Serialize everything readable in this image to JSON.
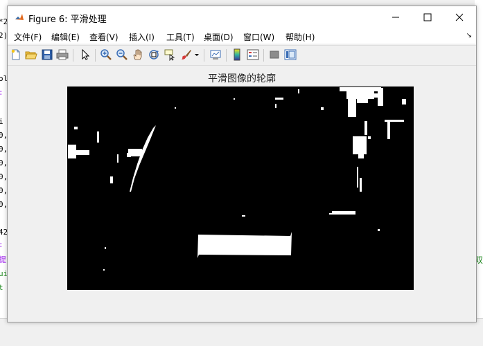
{
  "window": {
    "title": "Figure 6: 平滑处理",
    "controls": [
      "minimize",
      "maximize",
      "close"
    ]
  },
  "menu": {
    "items": [
      "文件(F)",
      "编辑(E)",
      "查看(V)",
      "插入(I)",
      "工具(T)",
      "桌面(D)",
      "窗口(W)",
      "帮助(H)"
    ]
  },
  "toolbar": {
    "buttons": [
      "new-figure-icon",
      "open-file-icon",
      "save-icon",
      "print-icon",
      "pointer-icon",
      "zoom-in-icon",
      "zoom-out-icon",
      "pan-icon",
      "rotate-3d-icon",
      "data-cursor-icon",
      "brush-icon",
      "link-plot-icon",
      "colorbar-icon",
      "legend-icon",
      "hide-plot-tools-icon",
      "show-plot-tools-icon"
    ]
  },
  "plot": {
    "title": "平滑图像的轮廓"
  },
  "background_editor": {
    "left_fragments": [
      "*2",
      "2)",
      "",
      "ol",
      ":",
      "",
      "i",
      "0,",
      "0,",
      "0,",
      "0,",
      "0,",
      "0,",
      "",
      "42",
      ":",
      "提",
      "ui",
      "t"
    ],
    "right_fragment": "双"
  }
}
